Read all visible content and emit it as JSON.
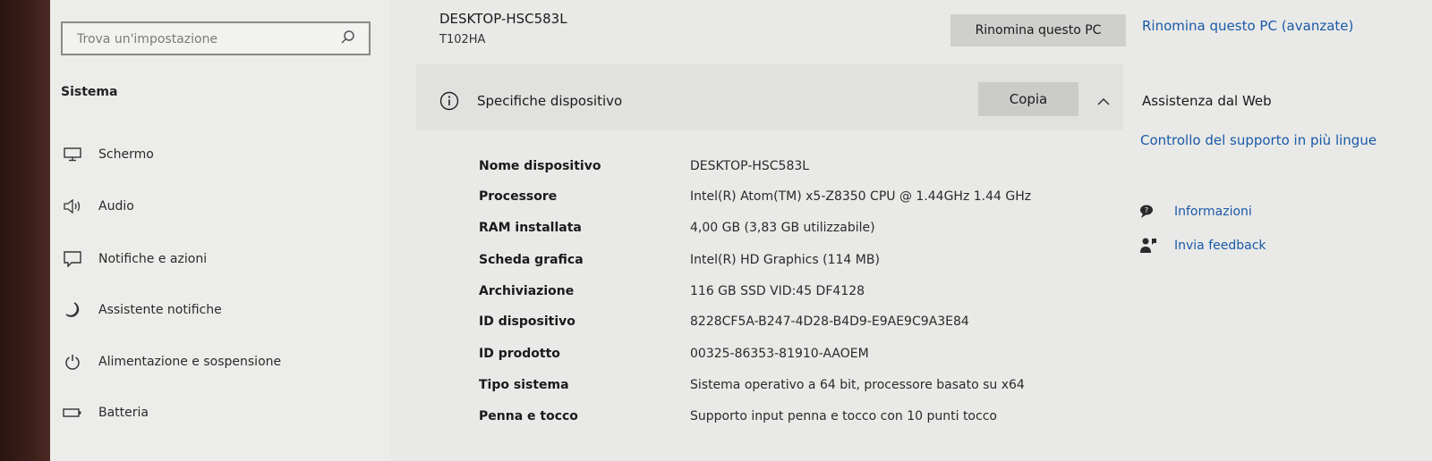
{
  "sidebar": {
    "search": {
      "placeholder": "Trova un'impostazione"
    },
    "section_title": "Sistema",
    "items": [
      {
        "label": "Schermo",
        "icon": "monitor-icon"
      },
      {
        "label": "Audio",
        "icon": "speaker-icon"
      },
      {
        "label": "Notifiche e azioni",
        "icon": "notification-icon"
      },
      {
        "label": "Assistente notifiche",
        "icon": "moon-icon"
      },
      {
        "label": "Alimentazione e sospensione",
        "icon": "power-icon"
      },
      {
        "label": "Batteria",
        "icon": "battery-icon"
      }
    ]
  },
  "main": {
    "pc_name": "DESKTOP-HSC583L",
    "pc_model": "T102HA",
    "rename_button": "Rinomina questo PC",
    "specs": {
      "title": "Specifiche dispositivo",
      "copy_button": "Copia",
      "rows": [
        {
          "key": "Nome dispositivo",
          "value": "DESKTOP-HSC583L"
        },
        {
          "key": "Processore",
          "value": "Intel(R) Atom(TM) x5-Z8350  CPU @ 1.44GHz   1.44 GHz"
        },
        {
          "key": "RAM installata",
          "value": "4,00 GB (3,83 GB utilizzabile)"
        },
        {
          "key": "Scheda grafica",
          "value": "Intel(R) HD Graphics (114 MB)"
        },
        {
          "key": "Archiviazione",
          "value": "116 GB SSD VID:45 DF4128"
        },
        {
          "key": "ID dispositivo",
          "value": "8228CF5A-B247-4D28-B4D9-E9AE9C9A3E84"
        },
        {
          "key": "ID prodotto",
          "value": "00325-86353-81910-AAOEM"
        },
        {
          "key": "Tipo sistema",
          "value": "Sistema operativo a 64 bit, processore basato su x64"
        },
        {
          "key": "Penna e tocco",
          "value": "Supporto input penna e tocco con 10 punti tocco"
        }
      ]
    }
  },
  "right": {
    "rename_advanced": "Rinomina questo PC (avanzate)",
    "help_title": "Assistenza dal Web",
    "multilang_link": "Controllo del supporto in più lingue",
    "info_label": "Informazioni",
    "feedback_label": "Invia feedback"
  },
  "colors": {
    "link": "#1a5aa8",
    "button": "#cfcfcd",
    "background": "#e9e9e7"
  }
}
